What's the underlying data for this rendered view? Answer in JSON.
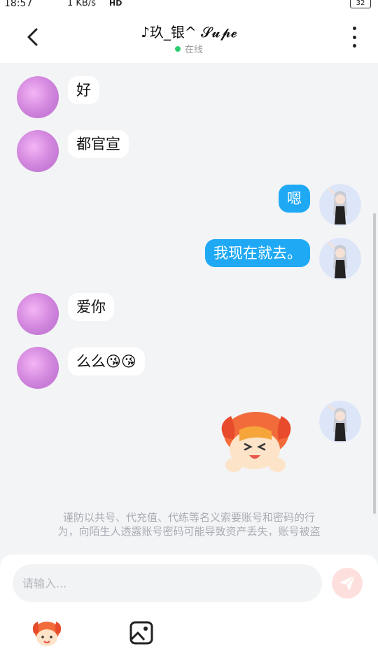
{
  "status_bar": {
    "time": "18:57",
    "network_speed": "1 KB/s",
    "network_badge": "HD",
    "battery": "32"
  },
  "header": {
    "title": "♪玖_银^ 𝓢𝓾𝓹𝓮",
    "status": "在线"
  },
  "messages": [
    {
      "from": "peer",
      "text": "好"
    },
    {
      "from": "peer",
      "text": "都官宣"
    },
    {
      "from": "me",
      "text": "嗯"
    },
    {
      "from": "me",
      "text": "我现在就去。"
    },
    {
      "from": "peer",
      "text": "爱你"
    },
    {
      "from": "peer",
      "text": "么么😘😘"
    },
    {
      "from": "me",
      "type": "sticker"
    }
  ],
  "warning": {
    "line1": "谨防以共号、代充值、代练等名义索要账号和密码的行",
    "line2": "为，向陌生人透露账号密码可能导致资产丢失，账号被盗"
  },
  "composer": {
    "placeholder": "请输入..."
  },
  "icons": {
    "back": "chevron-left-icon",
    "more": "more-vertical-icon",
    "send": "paper-plane-icon",
    "sticker": "sticker-icon",
    "image": "image-icon"
  },
  "colors": {
    "outgoing_bubble": "#1fa9f4",
    "online_dot": "#2ecc71",
    "send_button": "#fde0dd"
  }
}
